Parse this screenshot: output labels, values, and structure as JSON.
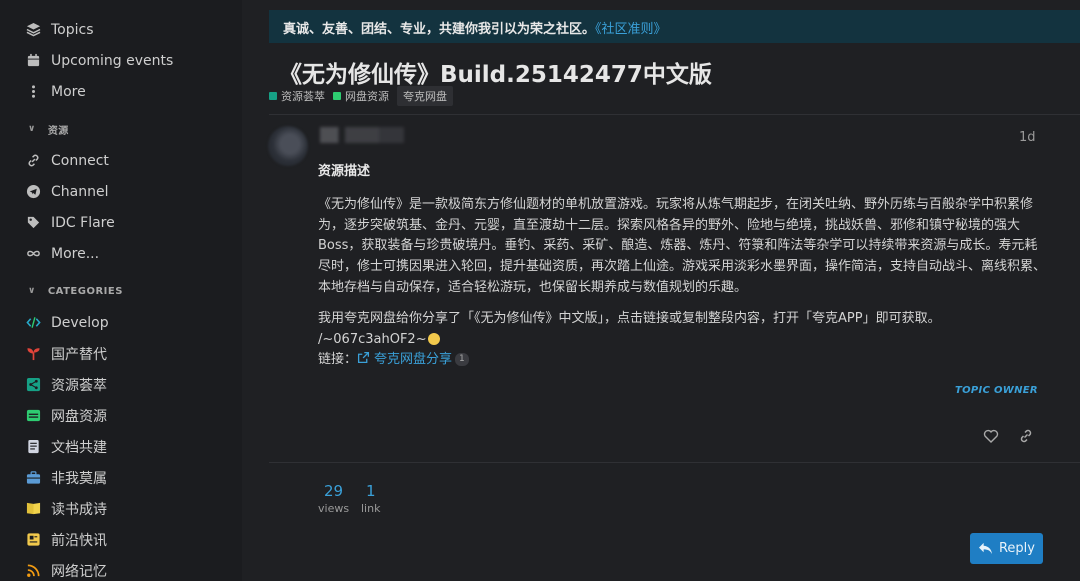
{
  "sidebar": {
    "top_items": [
      {
        "label": "Topics",
        "icon": "layers-icon"
      },
      {
        "label": "Upcoming events",
        "icon": "calendar-icon"
      },
      {
        "label": "More",
        "icon": "more-vertical-icon"
      }
    ],
    "sections": [
      {
        "title": "资源",
        "items": [
          {
            "label": "Connect",
            "icon": "link-icon"
          },
          {
            "label": "Channel",
            "icon": "telegram-icon"
          },
          {
            "label": "IDC Flare",
            "icon": "tag-icon"
          },
          {
            "label": "More...",
            "icon": "infinity-icon"
          }
        ]
      },
      {
        "title": "CATEGORIES",
        "items": [
          {
            "label": "Develop",
            "icon": "code-icon",
            "color": "#27a9c9"
          },
          {
            "label": "国产替代",
            "icon": "sprout-icon",
            "color": "#e0443a"
          },
          {
            "label": "资源荟萃",
            "icon": "share-icon",
            "color": "#16a085"
          },
          {
            "label": "网盘资源",
            "icon": "drive-icon",
            "color": "#2ecc71"
          },
          {
            "label": "文档共建",
            "icon": "document-icon",
            "color": "#d0d4e0"
          },
          {
            "label": "非我莫属",
            "icon": "briefcase-icon",
            "color": "#5b9bd5"
          },
          {
            "label": "读书成诗",
            "icon": "book-icon",
            "color": "#f2d34b"
          },
          {
            "label": "前沿快讯",
            "icon": "news-icon",
            "color": "#f2c94c"
          },
          {
            "label": "网络记忆",
            "icon": "rss-icon",
            "color": "#f39c12"
          }
        ]
      }
    ]
  },
  "banner": {
    "text": "真诚、友善、团结、专业，共建你我引以为荣之社区。",
    "link": "《社区准则》"
  },
  "topic": {
    "title": "《无为修仙传》Build.25142477中文版",
    "tags": [
      {
        "label": "资源荟萃",
        "color": "#16a085"
      },
      {
        "label": "网盘资源",
        "color": "#2ecc71"
      },
      {
        "label": "夸克网盘",
        "color": ""
      }
    ]
  },
  "post": {
    "age": "1d",
    "heading": "资源描述",
    "description": "《无为修仙传》是一款极简东方修仙题材的单机放置游戏。玩家将从炼气期起步，在闭关吐纳、野外历练与百般杂学中积累修为，逐步突破筑基、金丹、元婴，直至渡劫十二层。探索风格各异的野外、险地与绝境，挑战妖兽、邪修和镇守秘境的强大Boss，获取装备与珍贵破境丹。垂钓、采药、采矿、酿造、炼器、炼丹、符箓和阵法等杂学可以持续带来资源与成长。寿元耗尽时，修士可携因果进入轮回，提升基础资质，再次踏上仙途。游戏采用淡彩水墨界面，操作简洁，支持自动战斗、离线积累、本地存档与自动保存，适合轻松游玩，也保留长期养成与数值规划的乐趣。",
    "share_text": "我用夸克网盘给你分享了「《无为修仙传》中文版」，点击链接或复制整段内容，打开「夸克APP」即可获取。",
    "share_code": "/~067c3ahOF2~",
    "link_label": "链接：",
    "link_text": "夸克网盘分享",
    "link_count": "1",
    "owner_badge": "TOPIC OWNER"
  },
  "stats": {
    "views_value": "29",
    "views_label": "views",
    "link_value": "1",
    "link_label": "link"
  },
  "reply_button": "Reply",
  "colors": {
    "accent": "#3aa0d8",
    "button": "#1f7ec4",
    "banner_bg": "#13333f"
  }
}
